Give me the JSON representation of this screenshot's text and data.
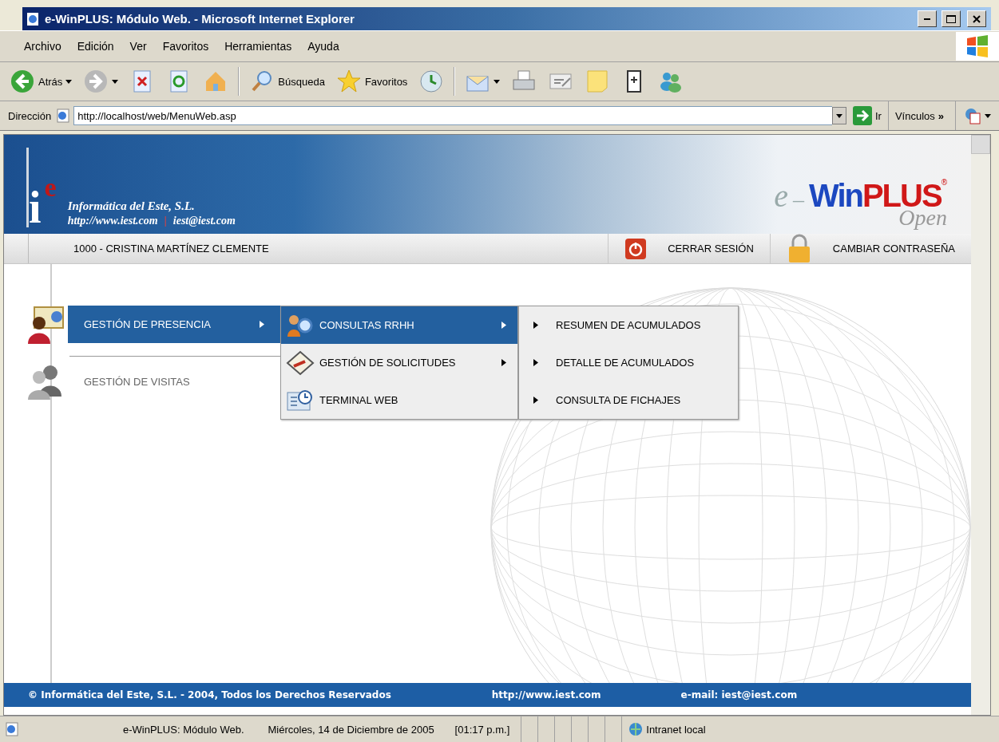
{
  "window": {
    "title": "e-WinPLUS: Módulo Web. - Microsoft Internet Explorer"
  },
  "menu_bar": [
    "Archivo",
    "Edición",
    "Ver",
    "Favoritos",
    "Herramientas",
    "Ayuda"
  ],
  "toolbar": [
    {
      "kind": "back",
      "label": "Atrás"
    },
    {
      "kind": "forward"
    },
    {
      "kind": "stop"
    },
    {
      "kind": "refresh"
    },
    {
      "kind": "home"
    },
    {
      "kind": "search",
      "label": "Búsqueda"
    },
    {
      "kind": "favorites",
      "label": "Favoritos"
    },
    {
      "kind": "history"
    },
    {
      "kind": "mail"
    },
    {
      "kind": "print"
    },
    {
      "kind": "edit"
    },
    {
      "kind": "note"
    },
    {
      "kind": "research"
    },
    {
      "kind": "messenger"
    }
  ],
  "address_bar": {
    "label": "Dirección",
    "value": "http://localhost/web/MenuWeb.asp",
    "go": "Ir",
    "links": "Vínculos",
    "chevron": "»"
  },
  "header": {
    "logo": [
      "i",
      "e"
    ],
    "company": "Informática del Este, S.L.",
    "web": "http://www.iest.com",
    "separator": "|",
    "email": "iest@iest.com",
    "product": {
      "prefix": "e",
      "dash": "–",
      "win": "Win",
      "plus": "PLUS",
      "reg": "®",
      "edition": "Open"
    }
  },
  "user_bar": {
    "user": "1000 - CRISTINA MARTÍNEZ CLEMENTE",
    "actions": [
      {
        "kind": "logout",
        "label": "CERRAR SESIÓN"
      },
      {
        "kind": "password",
        "label": "CAMBIAR CONTRASEÑA"
      }
    ]
  },
  "menu": [
    {
      "label": "GESTIÓN DE PRESENCIA",
      "selected": true,
      "has_submenu": true
    },
    {
      "label": "GESTIÓN DE VISITAS",
      "selected": false,
      "has_submenu": false
    }
  ],
  "submenu": [
    {
      "kind": "query",
      "label": "CONSULTAS RRHH",
      "selected": true,
      "has_submenu": true
    },
    {
      "kind": "request",
      "label": "GESTIÓN DE SOLICITUDES",
      "selected": false,
      "has_submenu": true
    },
    {
      "kind": "terminal",
      "label": "TERMINAL WEB",
      "selected": false,
      "has_submenu": false
    }
  ],
  "subsubmenu": [
    {
      "label": "RESUMEN DE ACUMULADOS"
    },
    {
      "label": "DETALLE DE ACUMULADOS"
    },
    {
      "label": "CONSULTA DE FICHAJES"
    }
  ],
  "footer": {
    "copyright": "© Informática del Este, S.L. - 2004, Todos los Derechos Reservados",
    "web": "http://www.iest.com",
    "email": "e-mail: iest@iest.com"
  },
  "status_bar": {
    "title": "e-WinPLUS: Módulo Web.",
    "date": "Miércoles, 14 de Diciembre de 2005",
    "time": "[01:17 p.m.]",
    "zone": "Intranet local"
  }
}
